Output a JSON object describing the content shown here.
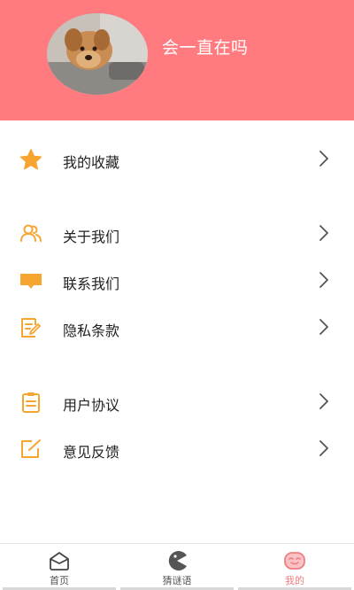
{
  "profile": {
    "username": "会一直在吗"
  },
  "menu": [
    {
      "label": "我的收藏",
      "icon": "star-icon"
    },
    {
      "label": "关于我们",
      "icon": "users-icon"
    },
    {
      "label": "联系我们",
      "icon": "message-icon"
    },
    {
      "label": "隐私条款",
      "icon": "document-edit-icon"
    },
    {
      "label": "用户协议",
      "icon": "clipboard-icon"
    },
    {
      "label": "意见反馈",
      "icon": "feedback-edit-icon"
    }
  ],
  "tabs": [
    {
      "label": "首页",
      "icon": "home-icon",
      "active": false
    },
    {
      "label": "猜谜语",
      "icon": "pacman-icon",
      "active": false
    },
    {
      "label": "我的",
      "icon": "smiley-icon",
      "active": true
    }
  ],
  "colors": {
    "header": "#FF7B7F",
    "accent_icon": "#F7A531",
    "active_tab": "#F07D82"
  }
}
